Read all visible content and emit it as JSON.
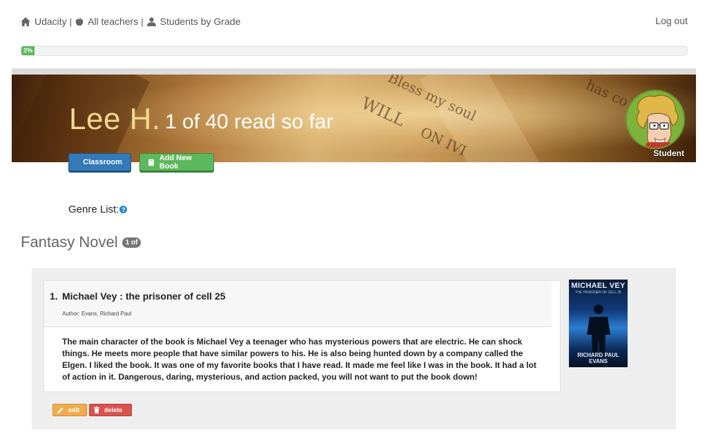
{
  "nav": {
    "home_label": "Udacity",
    "sep1": "|",
    "teachers_label": "All teachers",
    "sep2": "|",
    "grade_label": "Students by Grade",
    "logout_label": "Log out"
  },
  "progress": {
    "label": "2%",
    "value": 2
  },
  "banner": {
    "student_name": "Lee H.",
    "read_count": "1 of 40 read so far",
    "role": "Student",
    "deco_lines": [
      "Bless my soul",
      "WILL",
      "has co",
      "ON IVI"
    ]
  },
  "actions": {
    "classroom_label": "Classroom",
    "add_book_label": "Add New Book"
  },
  "genre_list": {
    "label": "Genre List:",
    "help": "?"
  },
  "section": {
    "title": "Fantasy Novel",
    "badge": "1 of"
  },
  "books": [
    {
      "number": "1.",
      "title": "Michael Vey : the prisoner of cell 25",
      "author": "Author: Evans, Richard Paul",
      "review": "The main character of the book is Michael Vey a teenager who has mysterious powers that are electric. He can shock things. He meets more people that have similar powers to his. He is also being hunted down by a company called the Elgen. I liked the book. It was one of my favorite books that I have read. It made me feel like I was in the book. It had a lot of action in it. Dangerous, daring, mysterious, and action packed, you will not want to put the book down!",
      "cover": {
        "title": "MICHAEL VEY",
        "subtitle": "THE PRISONER OF CELL 25",
        "author": "RICHARD PAUL EVANS"
      },
      "edit_label": "edit",
      "delete_label": "delete"
    }
  ],
  "colors": {
    "primary": "#337ab7",
    "success": "#5cb85c",
    "warning": "#f0ad4e",
    "danger": "#d9534f",
    "info": "#1e88c9"
  },
  "icons": {
    "home": "home-icon",
    "teachers": "apple-icon",
    "grade": "user-icon",
    "classroom": "monitor-icon",
    "add_book": "book-icon",
    "edit": "pencil-icon",
    "delete": "trash-icon"
  }
}
